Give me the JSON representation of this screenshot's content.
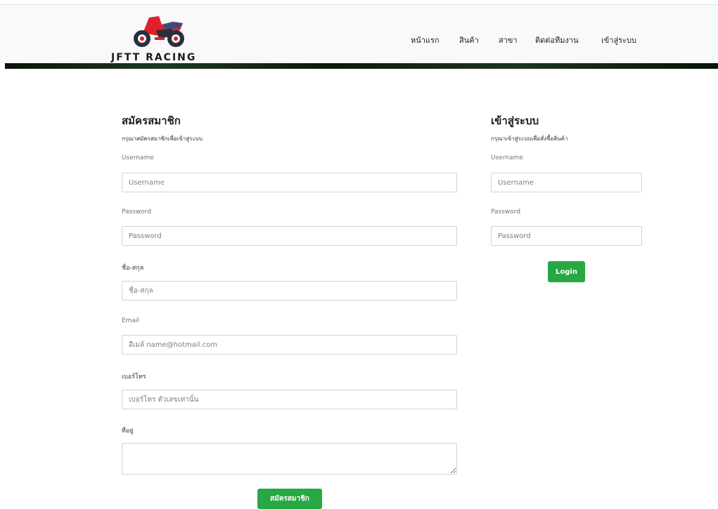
{
  "brand": {
    "name": "JFTT RACING",
    "logo_icon": "motorcycle-icon"
  },
  "nav": {
    "items": [
      {
        "label": "หน้าแรก"
      },
      {
        "label": "สินค้า"
      },
      {
        "label": "สาขา"
      },
      {
        "label": "ติดต่อทีมงาน"
      },
      {
        "label": "เข้าสู่ระบบ"
      }
    ]
  },
  "register": {
    "title": "สมัครสมาชิก",
    "subtitle": "กรุณาสมัครสมาชิกเพื่อเข้าสู่ระบบ",
    "username_label": "Username",
    "username_placeholder": "Username",
    "password_label": "Password",
    "password_placeholder": "Password",
    "fullname_label": "ชื่อ-สกุล",
    "fullname_placeholder": "ชื่อ-สกุล",
    "email_label": "Email",
    "email_placeholder": "อีเมล์ name@hotmail.com",
    "phone_label": "เบอร์โทร",
    "phone_placeholder": "เบอร์โทร ตัวเลขเท่านั้น",
    "address_label": "ที่อยู่",
    "submit_label": "สมัครสมาชิก"
  },
  "login": {
    "title": "เข้าสู่ระบบ",
    "subtitle": "กรุณาเข้าสู่ระบบเพื่อสั่งซื้อสินค้า",
    "username_label": "Username",
    "username_placeholder": "Username",
    "password_label": "Password",
    "password_placeholder": "Password",
    "submit_label": "Login"
  },
  "colors": {
    "accent": "#28a745",
    "navbar_bg": "#f8f9fa",
    "logo_red": "#e0202a",
    "logo_dark": "#2b2f3a"
  }
}
